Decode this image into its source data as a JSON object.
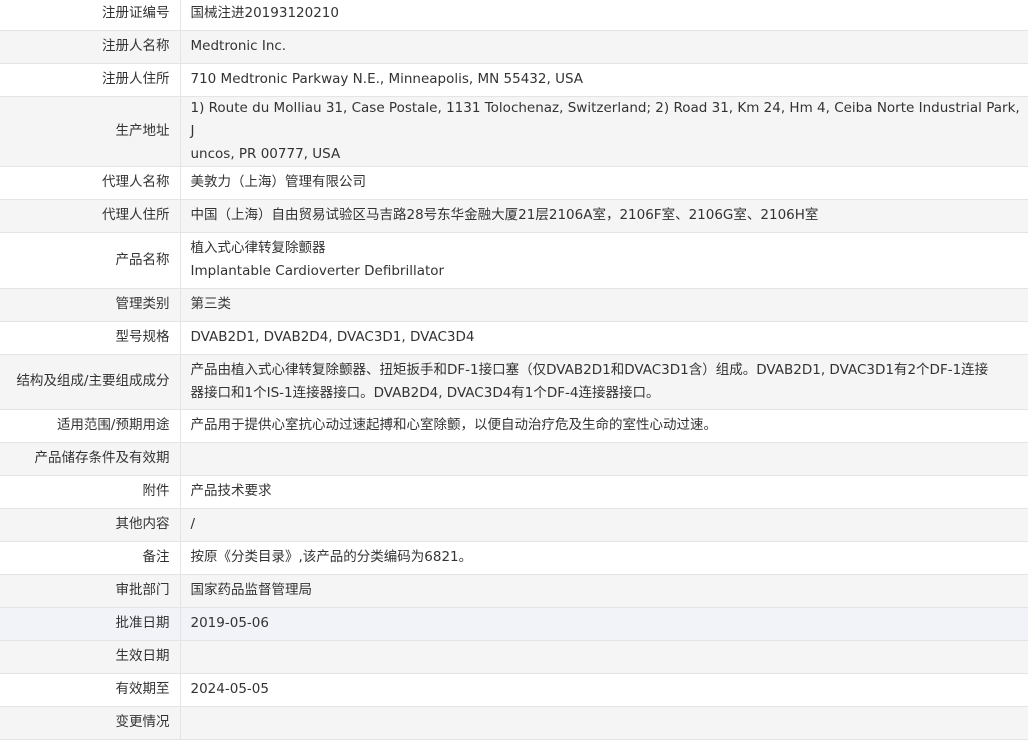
{
  "fields": {
    "reg_no": {
      "label": "注册证编号",
      "value": "国械注进20193120210"
    },
    "registrant": {
      "label": "注册人名称",
      "value": "Medtronic Inc."
    },
    "reg_address": {
      "label": "注册人住所",
      "value": "710 Medtronic Parkway N.E., Minneapolis, MN 55432, USA"
    },
    "prod_address": {
      "label": "生产地址",
      "line1": "1) Route du Molliau 31, Case Postale, 1131 Tolochenaz, Switzerland; 2) Road 31, Km 24, Hm 4, Ceiba Norte Industrial Park, J",
      "line2": "uncos, PR 00777, USA"
    },
    "agent_name": {
      "label": "代理人名称",
      "value": "美敦力（上海）管理有限公司"
    },
    "agent_address": {
      "label": "代理人住所",
      "value": "中国（上海）自由贸易试验区马吉路28号东华金融大厦21层2106A室，2106F室、2106G室、2106H室"
    },
    "product_name": {
      "label": "产品名称",
      "line1": "植入式心律转复除颤器",
      "line2": "Implantable Cardioverter Defibrillator"
    },
    "mgmt_class": {
      "label": "管理类别",
      "value": "第三类"
    },
    "models": {
      "label": "型号规格",
      "value": "DVAB2D1, DVAB2D4, DVAC3D1, DVAC3D4"
    },
    "structure": {
      "label": "结构及组成/主要组成成分",
      "line1": "产品由植入式心律转复除颤器、扭矩扳手和DF-1接口塞（仅DVAB2D1和DVAC3D1含）组成。DVAB2D1, DVAC3D1有2个DF-1连接",
      "line2": "器接口和1个IS-1连接器接口。DVAB2D4, DVAC3D4有1个DF-4连接器接口。"
    },
    "scope": {
      "label": "适用范围/预期用途",
      "value": "产品用于提供心室抗心动过速起搏和心室除颤，以便自动治疗危及生命的室性心动过速。"
    },
    "storage": {
      "label": "产品储存条件及有效期",
      "value": ""
    },
    "attachment": {
      "label": "附件",
      "value": "产品技术要求"
    },
    "other": {
      "label": "其他内容",
      "value": "/"
    },
    "remark": {
      "label": "备注",
      "value": "按原《分类目录》,该产品的分类编码为6821。"
    },
    "approval_dept": {
      "label": "审批部门",
      "value": "国家药品监督管理局"
    },
    "approval_date": {
      "label": "批准日期",
      "value": "2019-05-06"
    },
    "effective_date": {
      "label": "生效日期",
      "value": ""
    },
    "valid_until": {
      "label": "有效期至",
      "value": "2024-05-05"
    },
    "changes": {
      "label": "变更情况",
      "value": ""
    }
  }
}
